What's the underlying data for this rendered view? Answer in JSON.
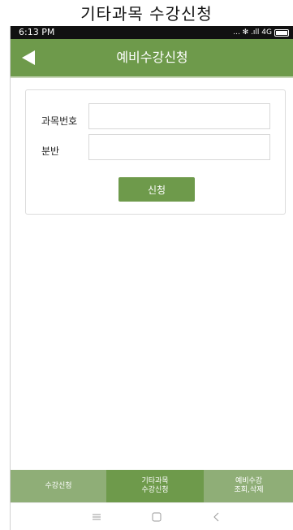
{
  "caption": "기타과목 수강신청",
  "status_bar": {
    "time": "6:13 PM",
    "indicators": "... ✻ .ıll 4G",
    "icons": [
      "bluetooth-icon",
      "signal-icon",
      "battery-icon"
    ]
  },
  "app_bar": {
    "title": "예비수강신청",
    "back_icon": "back-arrow-icon"
  },
  "form": {
    "course_number_label": "과목번호",
    "course_number_value": "",
    "section_label": "분반",
    "section_value": "",
    "submit_label": "신청"
  },
  "tabs": [
    {
      "line1": "수강신청",
      "line2": ""
    },
    {
      "line1": "기타과목",
      "line2": "수강신청"
    },
    {
      "line1": "예비수강",
      "line2": "조회,삭제"
    }
  ],
  "active_tab": 1,
  "nav_bar": {
    "icons": [
      "menu-icon",
      "home-icon",
      "back-icon"
    ]
  },
  "colors": {
    "primary": "#6e9a4b",
    "tab_inactive": "#8fae77",
    "status_bar": "#111111"
  }
}
